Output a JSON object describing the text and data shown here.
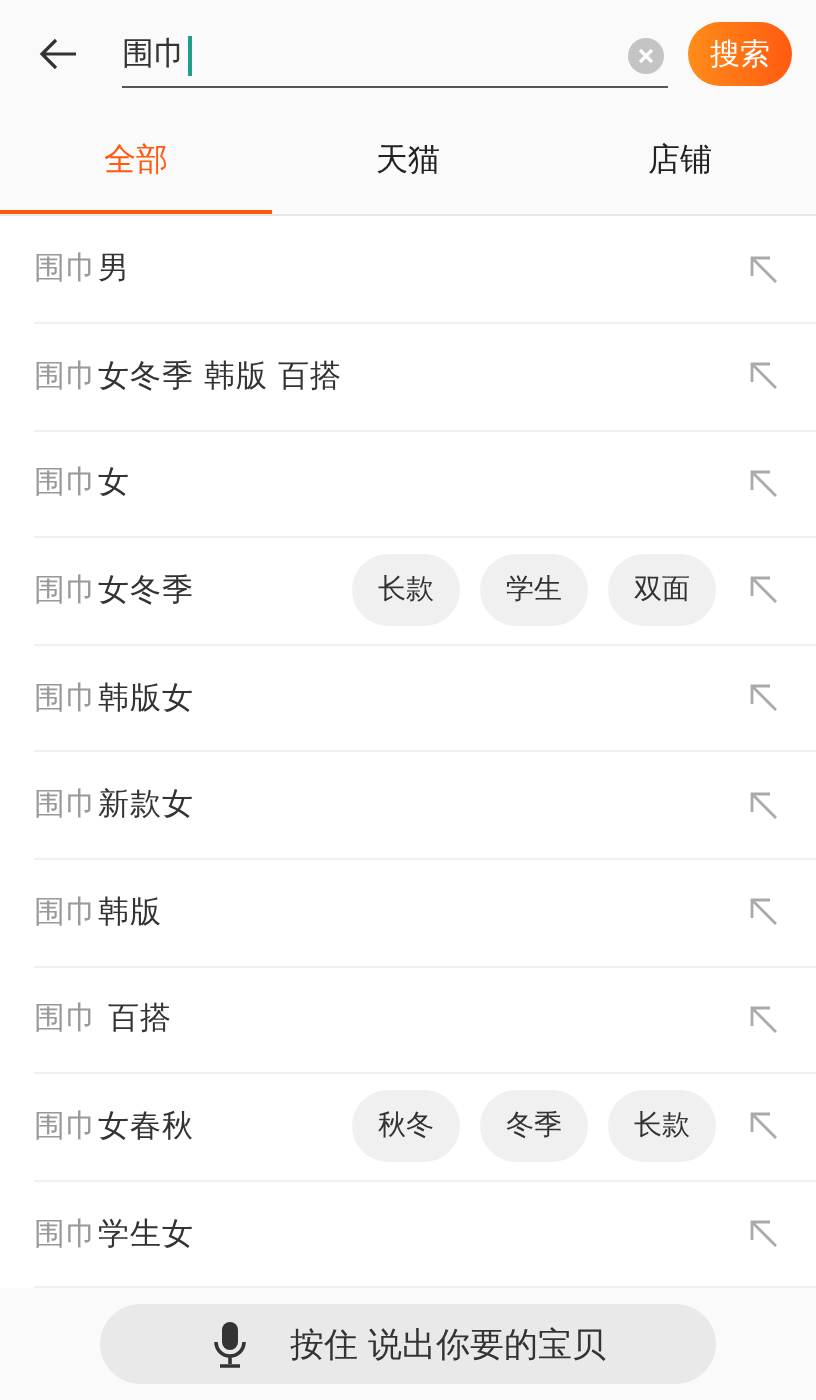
{
  "search": {
    "value": "围巾",
    "button": "搜索"
  },
  "tabs": [
    {
      "label": "全部",
      "selected": true
    },
    {
      "label": "天猫",
      "selected": false
    },
    {
      "label": "店铺",
      "selected": false
    }
  ],
  "suggestions": [
    {
      "match": "围巾",
      "rest": "男"
    },
    {
      "match": "围巾",
      "rest": "女冬季 韩版 百搭"
    },
    {
      "match": "围巾",
      "rest": "女"
    },
    {
      "match": "围巾",
      "rest": "女冬季",
      "tags": [
        "长款",
        "学生",
        "双面"
      ]
    },
    {
      "match": "围巾",
      "rest": "韩版女"
    },
    {
      "match": "围巾",
      "rest": "新款女"
    },
    {
      "match": "围巾",
      "rest": "韩版"
    },
    {
      "match": "围巾",
      "rest": " 百搭"
    },
    {
      "match": "围巾",
      "rest": "女春秋",
      "tags": [
        "秋冬",
        "冬季",
        "长款"
      ]
    },
    {
      "match": "围巾",
      "rest": "学生女"
    }
  ],
  "voice_button": "按住 说出你要的宝贝"
}
